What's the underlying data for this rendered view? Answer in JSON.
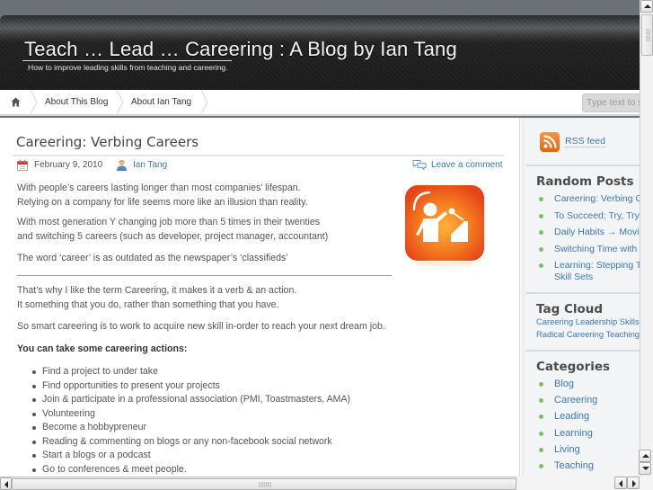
{
  "header": {
    "site_title": "Teach … Lead … Careering : A Blog by Ian Tang",
    "site_description": "How to improve leading skills from teaching and careering."
  },
  "nav": {
    "home_icon": "home-icon",
    "items": [
      {
        "label": "About This Blog"
      },
      {
        "label": "About Ian Tang"
      }
    ],
    "search_placeholder": "Type text to search"
  },
  "post": {
    "title": "Careering: Verbing Careers",
    "date": "February 9, 2010",
    "author": "Ian Tang",
    "comment_link": "Leave a comment",
    "paragraphs": [
      [
        "With people’s careers lasting longer than most companies’ lifespan.",
        "Relying on a company for life seems more like an illusion than reality."
      ],
      [
        "With most generation Y changing job more than 5 times in their twenties",
        "and switching 5 careers (such as developer, project manager, accountant)"
      ],
      [
        "The word ‘career’ is as outdated as the newspaper’s ‘classifieds’"
      ],
      [
        "That’s why I like the term Careering, it makes it a verb & an action.",
        "It something that you do, rather than something that you have."
      ],
      [
        "So smart careering is to work to acquire new skill in-order to reach your next dream job."
      ]
    ],
    "actions_heading": "You can take some careering actions:",
    "actions": [
      "Find a project to under take",
      "Find opportunities to present your projects",
      "Join & participate in a professional association (PMI, Toastmasters, AMA)",
      "Volunteering",
      "Become a hobbypreneur",
      "Reading & commenting on blogs or any non-facebook social network",
      "Start a blogs or a podcast",
      "Go to conferences & meet people."
    ],
    "image_icon": "speaker-at-podium-icon",
    "accent_color": "#f06a1a"
  },
  "sidebar": {
    "rss_label": "RSS feed",
    "random_posts": {
      "heading": "Random Posts",
      "items": [
        "Careering: Verbing Careers",
        "To Succeed: Try, Try",
        "Daily Habits → Moving",
        "Switching Time with",
        "Learning: Stepping T",
        "Skill Sets"
      ]
    },
    "tag_cloud": {
      "heading": "Tag Cloud",
      "lines": [
        "Careering Leadership Skills",
        "Radical Careering Teaching"
      ]
    },
    "categories": {
      "heading": "Categories",
      "items": [
        "Blog",
        "Careering",
        "Leading",
        "Learning",
        "Living",
        "Teaching"
      ]
    },
    "link_color": "#3c78b5",
    "bullet_color": "#7bbd6a"
  }
}
